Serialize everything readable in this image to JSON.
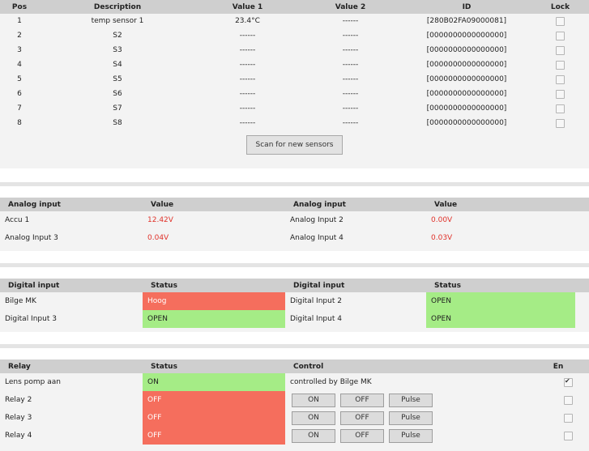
{
  "sensors": {
    "headers": [
      "Pos",
      "Description",
      "Value 1",
      "Value 2",
      "ID",
      "Lock"
    ],
    "rows": [
      {
        "pos": "1",
        "description": "temp sensor 1",
        "value1": "23.4°C",
        "value2": "------",
        "id": "[280B02FA09000081]",
        "lock": false
      },
      {
        "pos": "2",
        "description": "S2",
        "value1": "------",
        "value2": "------",
        "id": "[0000000000000000]",
        "lock": false
      },
      {
        "pos": "3",
        "description": "S3",
        "value1": "------",
        "value2": "------",
        "id": "[0000000000000000]",
        "lock": false
      },
      {
        "pos": "4",
        "description": "S4",
        "value1": "------",
        "value2": "------",
        "id": "[0000000000000000]",
        "lock": false
      },
      {
        "pos": "5",
        "description": "S5",
        "value1": "------",
        "value2": "------",
        "id": "[0000000000000000]",
        "lock": false
      },
      {
        "pos": "6",
        "description": "S6",
        "value1": "------",
        "value2": "------",
        "id": "[0000000000000000]",
        "lock": false
      },
      {
        "pos": "7",
        "description": "S7",
        "value1": "------",
        "value2": "------",
        "id": "[0000000000000000]",
        "lock": false
      },
      {
        "pos": "8",
        "description": "S8",
        "value1": "------",
        "value2": "------",
        "id": "[0000000000000000]",
        "lock": false
      }
    ],
    "scan_label": "Scan for new sensors"
  },
  "analog": {
    "headers": [
      "Analog input",
      "Value",
      "Analog input",
      "Value"
    ],
    "rows": [
      {
        "name1": "Accu 1",
        "value1": "12.42V",
        "name2": "Analog Input 2",
        "value2": "0.00V"
      },
      {
        "name1": "Analog Input 3",
        "value1": "0.04V",
        "name2": "Analog Input 4",
        "value2": "0.03V"
      }
    ]
  },
  "digital": {
    "headers": [
      "Digital input",
      "Status",
      "Digital input",
      "Status"
    ],
    "rows": [
      {
        "name1": "Bilge MK",
        "status1": "Hoog",
        "status1_color": "#f56e5d",
        "name2": "Digital Input 2",
        "status2": "OPEN",
        "status2_color": "#a5ec86"
      },
      {
        "name1": "Digital Input 3",
        "status1": "OPEN",
        "status1_color": "#a5ec86",
        "name2": "Digital Input 4",
        "status2": "OPEN",
        "status2_color": "#a5ec86"
      }
    ]
  },
  "relay": {
    "headers": [
      "Relay",
      "Status",
      "Control",
      "En"
    ],
    "button_on": "ON",
    "button_off": "OFF",
    "button_pulse": "Pulse",
    "rows": [
      {
        "name": "Lens pomp aan",
        "status": "ON",
        "status_color": "#a5ec86",
        "control_text": "controlled by Bilge MK",
        "enabled": true
      },
      {
        "name": "Relay 2",
        "status": "OFF",
        "status_color": "#f56e5d",
        "control_text": "",
        "enabled": false
      },
      {
        "name": "Relay 3",
        "status": "OFF",
        "status_color": "#f56e5d",
        "control_text": "",
        "enabled": false
      },
      {
        "name": "Relay 4",
        "status": "OFF",
        "status_color": "#f56e5d",
        "control_text": "",
        "enabled": false
      }
    ]
  },
  "colors": {
    "header_bg": "#cfcfcf",
    "panel_bg": "#f3f3f3",
    "value_red": "#e0322a",
    "status_red": "#f56e5d",
    "status_green": "#a5ec86"
  }
}
